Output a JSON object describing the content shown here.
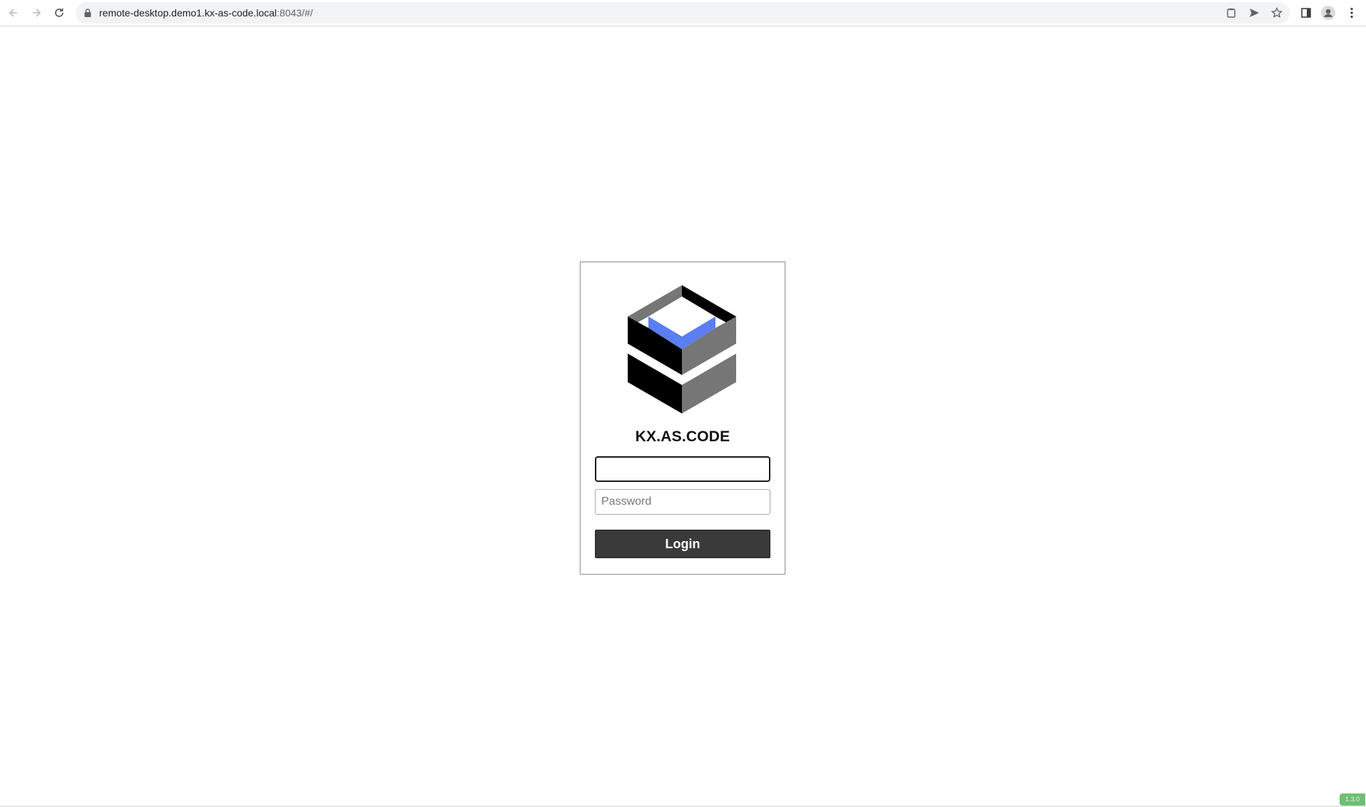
{
  "browser": {
    "url_host": "remote-desktop.demo1.kx-as-code.local",
    "url_rest": ":8043/#/",
    "icons": {
      "back": "arrow-left-icon",
      "forward": "arrow-right-icon",
      "reload": "reload-icon",
      "lock": "lock-icon",
      "tab_search": "clipboard-icon",
      "send": "send-icon",
      "bookmark": "star-icon",
      "side_panel": "side-panel-icon",
      "profile": "profile-avatar-icon",
      "menu": "kebab-menu-icon"
    }
  },
  "login": {
    "brand": "KX.AS.CODE",
    "username_value": "",
    "username_placeholder": "",
    "password_placeholder": "Password",
    "login_label": "Login",
    "logo": "kx-as-code-cube-logo"
  },
  "footer": {
    "version": "1.3.0"
  },
  "colors": {
    "logo_blue": "#5b7ef5",
    "logo_gray": "#767676",
    "logo_black": "#000000",
    "button_bg": "#3a3a3a",
    "version_badge": "#6fbf73"
  }
}
